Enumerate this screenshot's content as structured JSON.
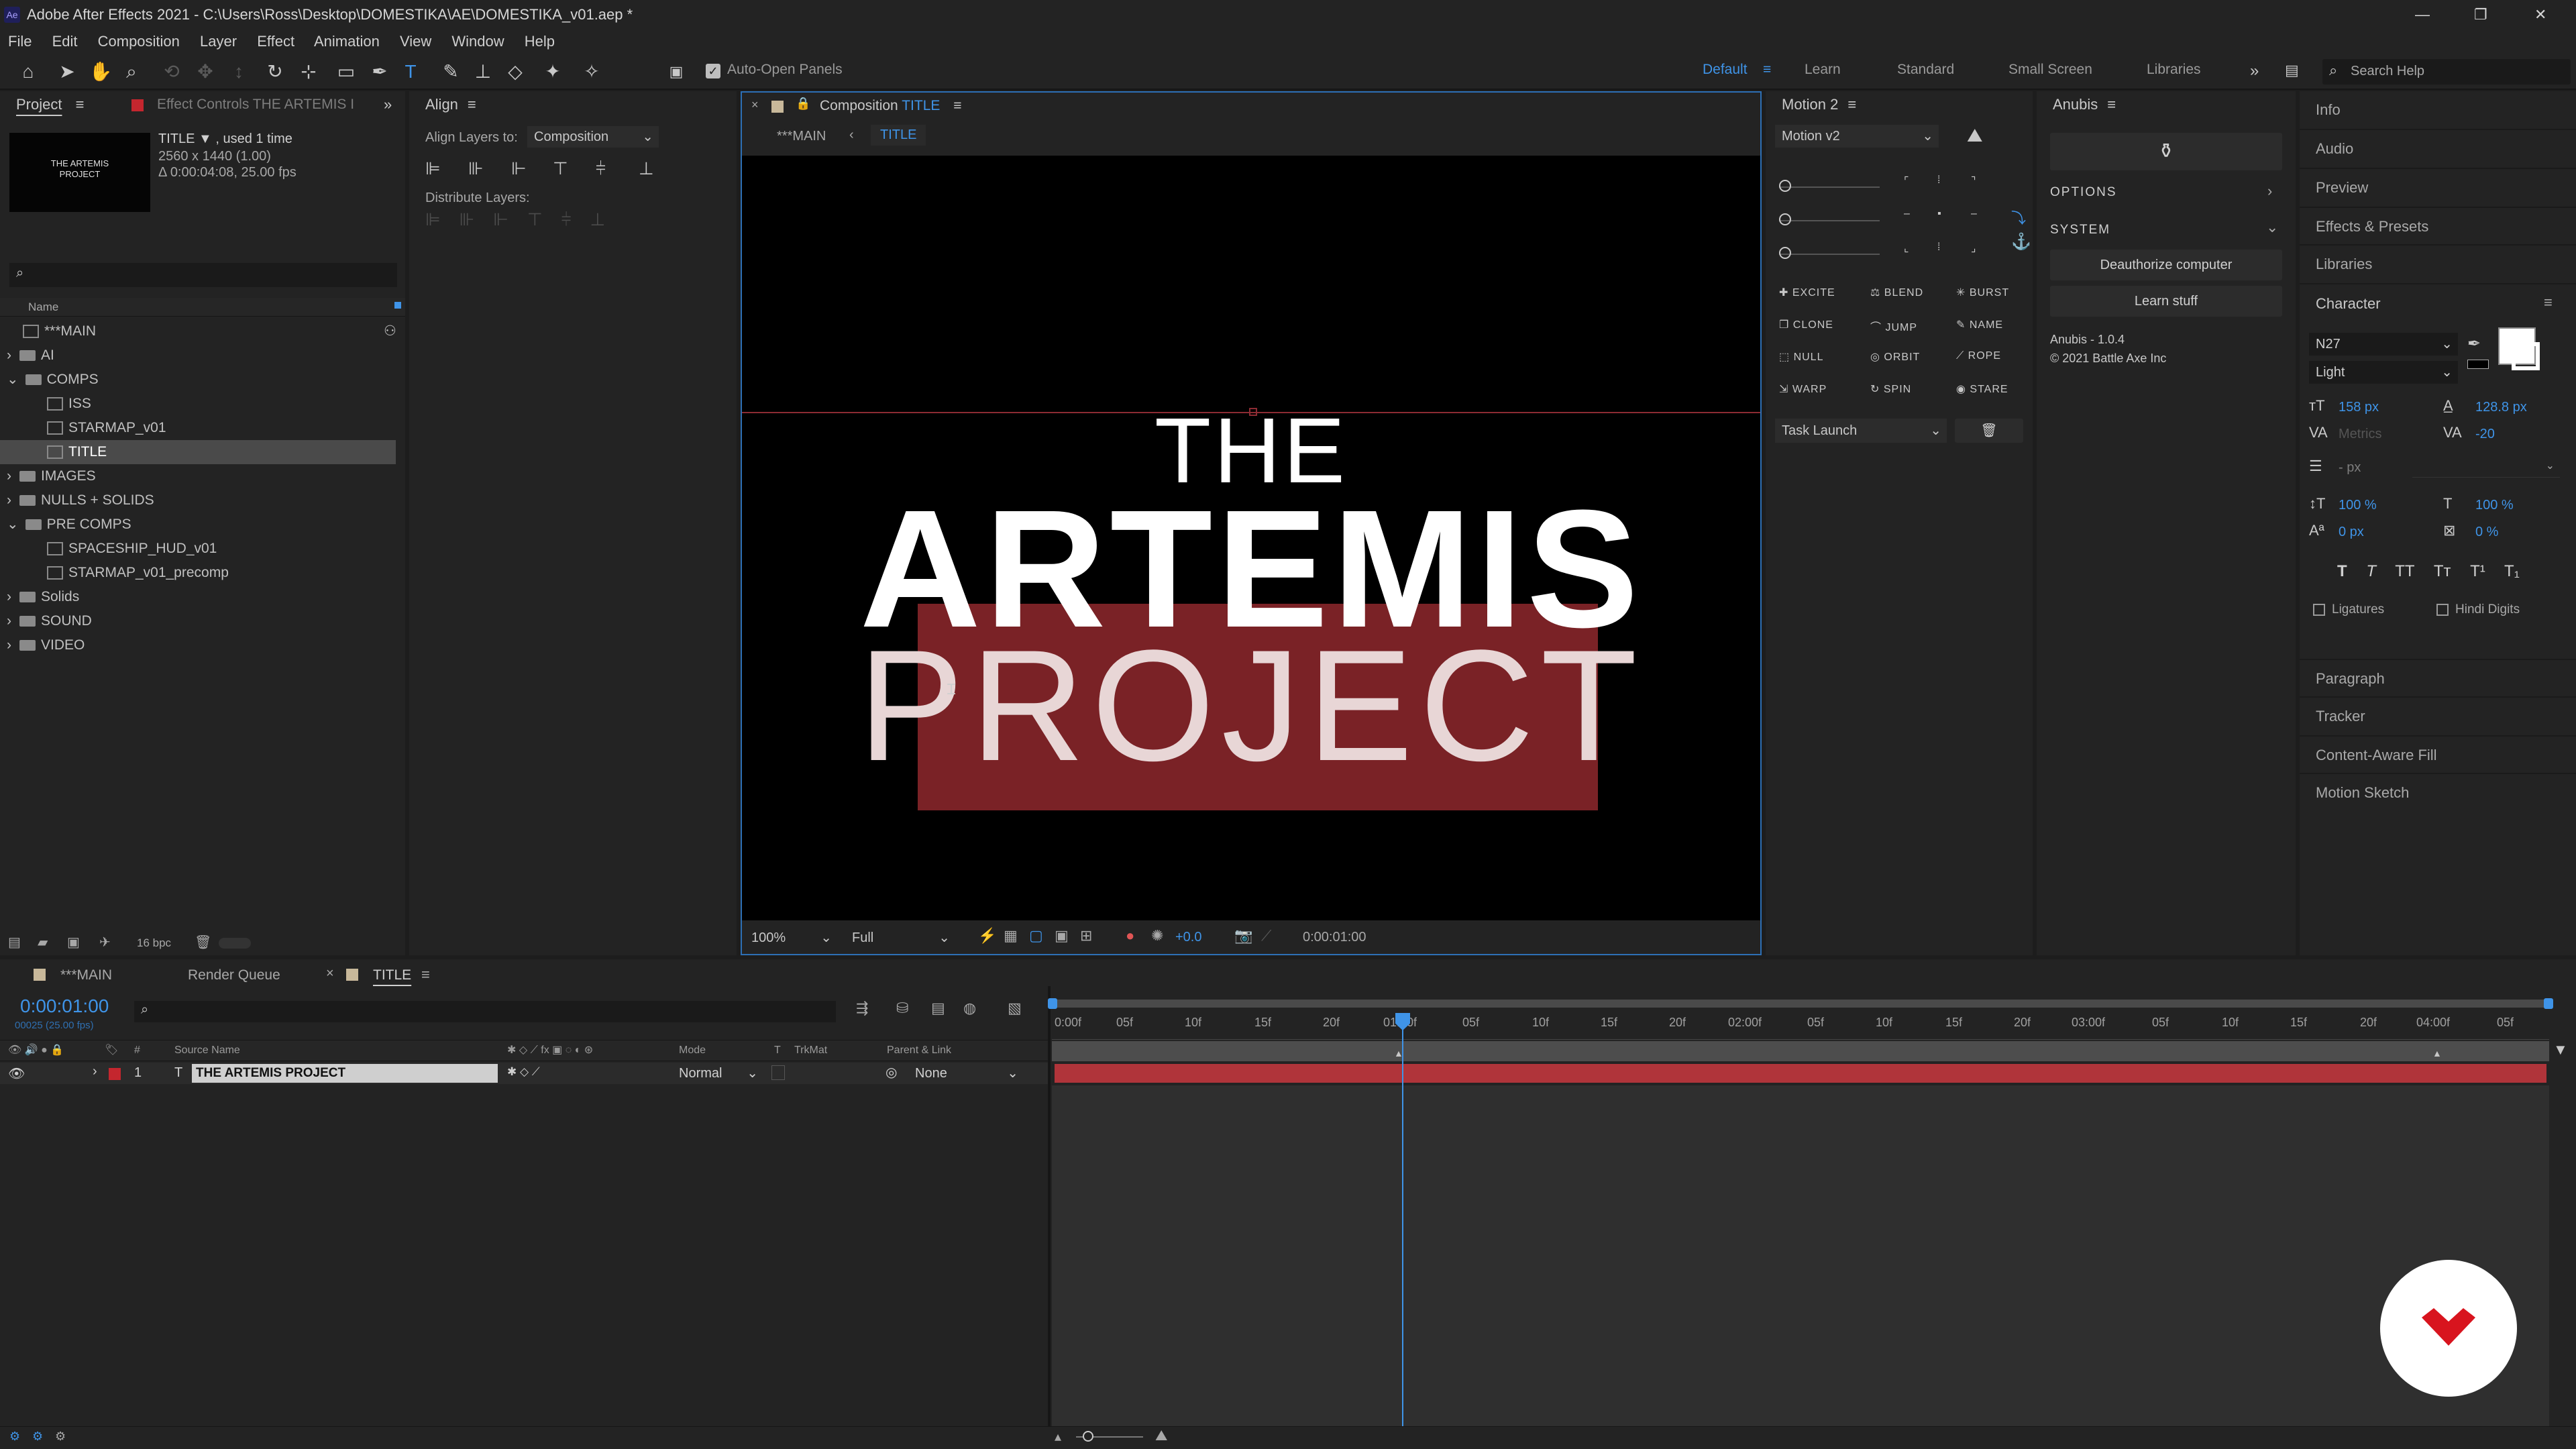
{
  "window": {
    "title": "Adobe After Effects 2021 - C:\\Users\\Ross\\Desktop\\DOMESTIKA\\AE\\DOMESTIKA_v01.aep *",
    "icon_label": "Ae",
    "controls": [
      "—",
      "❐",
      "✕"
    ]
  },
  "menu": [
    "File",
    "Edit",
    "Composition",
    "Layer",
    "Effect",
    "Animation",
    "View",
    "Window",
    "Help"
  ],
  "toolbar": {
    "auto_open": "Auto-Open Panels",
    "workspaces": [
      "Default",
      "Learn",
      "Standard",
      "Small Screen",
      "Libraries"
    ],
    "search_placeholder": "Search Help"
  },
  "project": {
    "tab": "Project",
    "effect_tab": "Effect Controls THE  ARTEMIS  I",
    "item_name": "TITLE ▼ , used 1 time",
    "item_res": "2560 x 1440 (1.00)",
    "item_dur": "Δ 0:00:04:08, 25.00 fps",
    "thumb_line1": "THE ARTEMIS",
    "thumb_line2": "PROJECT",
    "col_name": "Name",
    "bpc": "16 bpc",
    "items": [
      {
        "label": "***MAIN",
        "type": "comp",
        "indent": 0
      },
      {
        "label": "AI",
        "type": "folder",
        "indent": 0
      },
      {
        "label": "COMPS",
        "type": "folder",
        "indent": 0
      },
      {
        "label": "ISS",
        "type": "comp",
        "indent": 1
      },
      {
        "label": "STARMAP_v01",
        "type": "comp",
        "indent": 1
      },
      {
        "label": "TITLE",
        "type": "comp",
        "indent": 1
      },
      {
        "label": "IMAGES",
        "type": "folder",
        "indent": 0
      },
      {
        "label": "NULLS + SOLIDS",
        "type": "folder",
        "indent": 0
      },
      {
        "label": "PRE COMPS",
        "type": "folder",
        "indent": 0
      },
      {
        "label": "SPACESHIP_HUD_v01",
        "type": "comp",
        "indent": 1
      },
      {
        "label": "STARMAP_v01_precomp",
        "type": "comp",
        "indent": 1
      },
      {
        "label": "Solids",
        "type": "folder",
        "indent": 0
      },
      {
        "label": "SOUND",
        "type": "folder",
        "indent": 0
      },
      {
        "label": "VIDEO",
        "type": "folder",
        "indent": 0
      }
    ]
  },
  "align": {
    "tab": "Align",
    "align_to_label": "Align Layers to:",
    "align_to_value": "Composition",
    "distribute_label": "Distribute Layers:"
  },
  "composition": {
    "tab_prefix": "Composition",
    "tab_name": "TITLE",
    "crumb_main": "***MAIN",
    "crumb_title": "TITLE",
    "line1": "THE",
    "line2": "ARTEMIS",
    "line3": "PROJECT",
    "zoom": "100%",
    "resolution": "Full",
    "exposure": "+0.0",
    "timecode": "0:00:01:00",
    "highlight_color": "#7a2226"
  },
  "motion": {
    "tab": "Motion 2",
    "preset": "Motion v2",
    "buttons": [
      "EXCITE",
      "BLEND",
      "BURST",
      "CLONE",
      "JUMP",
      "NAME",
      "NULL",
      "ORBIT",
      "ROPE",
      "WARP",
      "SPIN",
      "STARE"
    ],
    "task": "Task Launch"
  },
  "anubis": {
    "tab": "Anubis",
    "options": "OPTIONS",
    "system": "SYSTEM",
    "deauth": "Deauthorize computer",
    "learn": "Learn stuff",
    "version": "Anubis - 1.0.4",
    "copyright": "© 2021 Battle Axe Inc"
  },
  "right_panels": [
    "Info",
    "Audio",
    "Preview",
    "Effects & Presets",
    "Libraries"
  ],
  "character": {
    "tab": "Character",
    "font": "N27",
    "style": "Light",
    "size": "158 px",
    "leading": "128.8 px",
    "kerning": "Metrics",
    "tracking": "-20",
    "stroke": "- px",
    "vscale": "100 %",
    "hscale": "100 %",
    "baseline": "0 px",
    "tsume": "0 %",
    "ligatures": "Ligatures",
    "hindi": "Hindi Digits",
    "styles": [
      "T",
      "T",
      "TT",
      "Tт",
      "T¹",
      "T₁"
    ]
  },
  "right_panels_lower": [
    "Paragraph",
    "Tracker",
    "Content-Aware Fill",
    "Motion Sketch"
  ],
  "timeline": {
    "tabs": [
      "***MAIN",
      "Render Queue",
      "TITLE"
    ],
    "timecode": "0:00:01:00",
    "frames": "00025 (25.00 fps)",
    "columns": {
      "source": "Source Name",
      "mode": "Mode",
      "t": "T",
      "trkmat": "TrkMat",
      "parent": "Parent & Link"
    },
    "layer": {
      "num": "1",
      "type": "T",
      "name": "THE  ARTEMIS  PROJECT",
      "mode": "Normal",
      "parent": "None"
    },
    "ticks": [
      "0:00f",
      "05f",
      "10f",
      "15f",
      "20f",
      "01:00f",
      "05f",
      "10f",
      "15f",
      "20f",
      "02:00f",
      "05f",
      "10f",
      "15f",
      "20f",
      "03:00f",
      "05f",
      "10f",
      "15f",
      "20f",
      "04:00f",
      "05f"
    ],
    "layer_color": "#b0343a"
  },
  "logo": {
    "color": "#d8141e"
  }
}
